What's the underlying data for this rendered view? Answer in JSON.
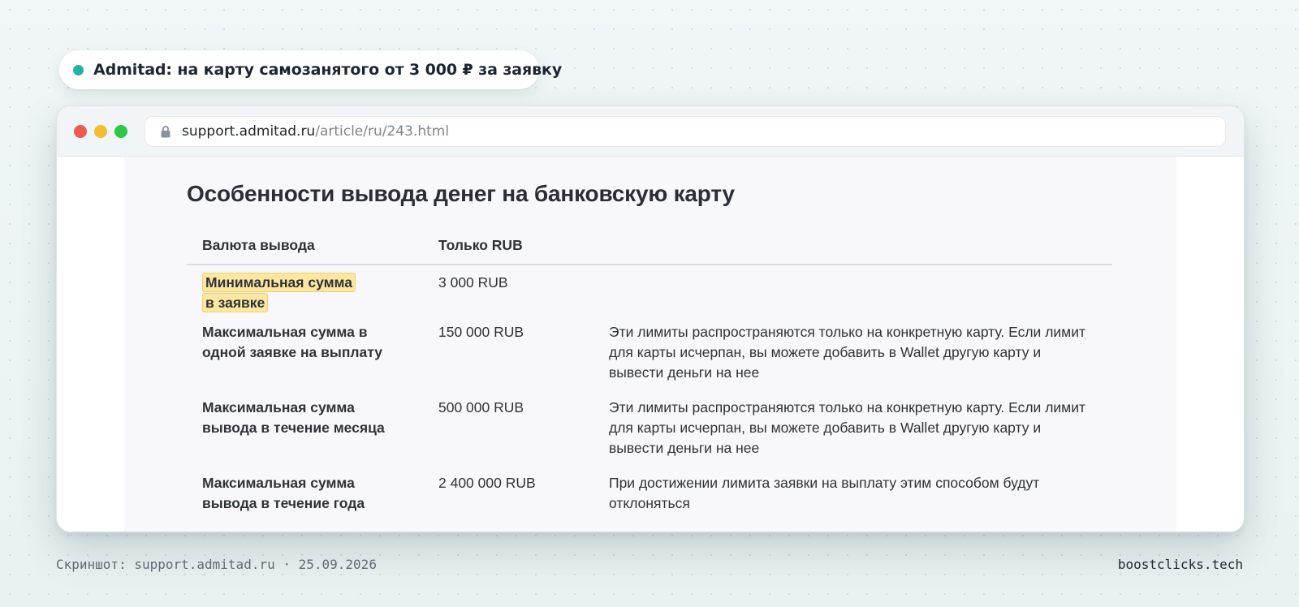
{
  "pill": {
    "title": "Admitad: на карту самозанятого от 3 000 ₽ за заявку",
    "dot_color": "#1fb3a6"
  },
  "browser": {
    "url_host": "support.admitad.ru",
    "url_path": "/article/ru/243.html",
    "icon": "lock-icon"
  },
  "article": {
    "title": "Особенности вывода денег на банковскую карту",
    "table": {
      "headers": [
        "Валюта вывода",
        "Только RUB",
        ""
      ],
      "rows": [
        {
          "label": "Минимальная сумма в заявке",
          "value": "3 000 RUB",
          "note": "",
          "highlighted": true
        },
        {
          "label": "Максимальная сумма в одной заявке на выплату",
          "value": "150 000 RUB",
          "note": "Эти лимиты распространяются только на конкретную карту. Если лимит для карты исчерпан, вы можете добавить в Wallet другую карту и вывести деньги на нее",
          "highlighted": false
        },
        {
          "label": "Максимальная сумма вывода в течение месяца",
          "value": "500 000 RUB",
          "note": "Эти лимиты распространяются только на конкретную карту. Если лимит для карты исчерпан, вы можете добавить в Wallet другую карту и вывести деньги на нее",
          "highlighted": false
        },
        {
          "label": "Максимальная сумма вывода в течение года",
          "value": "2 400 000 RUB",
          "note": "При достижении лимита заявки на выплату этим способом будут отклоняться",
          "highlighted": false
        }
      ]
    }
  },
  "footer": {
    "left": "Скриншот: support.admitad.ru · 25.09.2026",
    "right": "boostclicks.tech"
  },
  "colors": {
    "highlight": "#fce7a1",
    "accent": "#1fb3a6"
  }
}
